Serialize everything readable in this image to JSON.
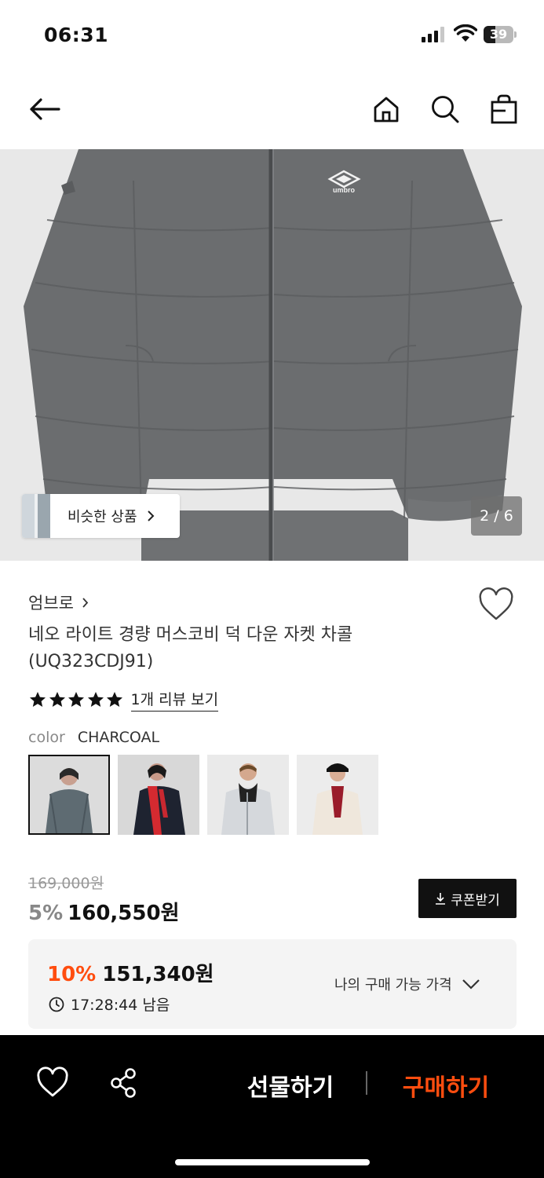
{
  "status_bar": {
    "time": "06:31",
    "battery": "39"
  },
  "hero": {
    "similar_label": "비슷한 상품",
    "page_indicator": "2 / 6",
    "logo_text": "umbro"
  },
  "product": {
    "brand": "엄브로",
    "title": "네오 라이트 경량 머스코비 덕 다운 자켓 차콜 (UQ323CDJ91)",
    "rating": 5,
    "review_link": "1개 리뷰 보기",
    "color_label": "color",
    "color_value": "CHARCOAL",
    "swatch_count": 4,
    "selected_swatch": 0
  },
  "price": {
    "original": "169,000원",
    "discount": "5%",
    "sale": "160,550원",
    "coupon_label": "쿠폰받기"
  },
  "member": {
    "discount": "10%",
    "price": "151,340원",
    "timer": "17:28:44 남음",
    "available_label": "나의 구매 가능 가격"
  },
  "bottom_bar": {
    "gift_label": "선물하기",
    "buy_label": "구매하기"
  },
  "colors": {
    "accent": "#ff4d0f",
    "dark": "#111111",
    "panel": "#f4f4f4"
  }
}
